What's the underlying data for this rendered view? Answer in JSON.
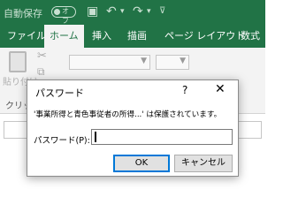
{
  "quick_access": {
    "autosave_label": "自動保存",
    "autosave_state": "オフ",
    "save_icon": "save-icon",
    "undo_icon": "undo-icon",
    "redo_icon": "redo-icon",
    "customize_icon": "customize-icon"
  },
  "ribbon_tabs": [
    {
      "label": "ファイル"
    },
    {
      "label": "ホーム",
      "active": true
    },
    {
      "label": "挿入"
    },
    {
      "label": "描画"
    },
    {
      "label": "ページ レイアウト"
    },
    {
      "label": "数式"
    }
  ],
  "clipboard_group": {
    "paste_label": "貼り付け",
    "group_label": "クリップボ"
  },
  "dialog": {
    "title": "パスワード",
    "help": "?",
    "close": "✕",
    "message": "'事業所得と青色事従者の所得...' は保護されています。",
    "password_label": "パスワード(P):",
    "password_value": "",
    "ok_label": "OK",
    "cancel_label": "キャンセル"
  },
  "colors": {
    "excel_green": "#217346",
    "ribbon_bg": "#f3f3f3",
    "ok_border": "#0078d7"
  }
}
